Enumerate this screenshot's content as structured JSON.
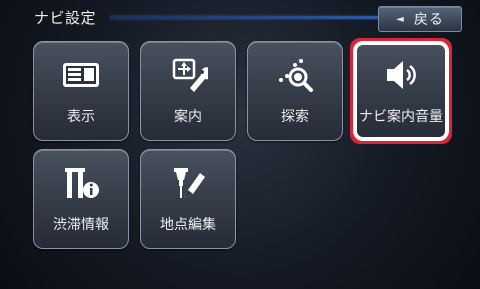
{
  "header": {
    "title": "ナビ設定",
    "back_arrow": "◄",
    "back_label": "戻る"
  },
  "tiles": [
    {
      "label": "表示",
      "icon": "display-icon"
    },
    {
      "label": "案内",
      "icon": "guidance-icon"
    },
    {
      "label": "探索",
      "icon": "search-route-icon"
    },
    {
      "label": "ナビ案内音量",
      "icon": "speaker-volume-icon"
    },
    {
      "label": "渋滞情報",
      "icon": "traffic-info-icon"
    },
    {
      "label": "地点編集",
      "icon": "point-edit-icon"
    }
  ],
  "colors": {
    "selection": "#d7263a",
    "accent_line": "#2c5aa8"
  }
}
